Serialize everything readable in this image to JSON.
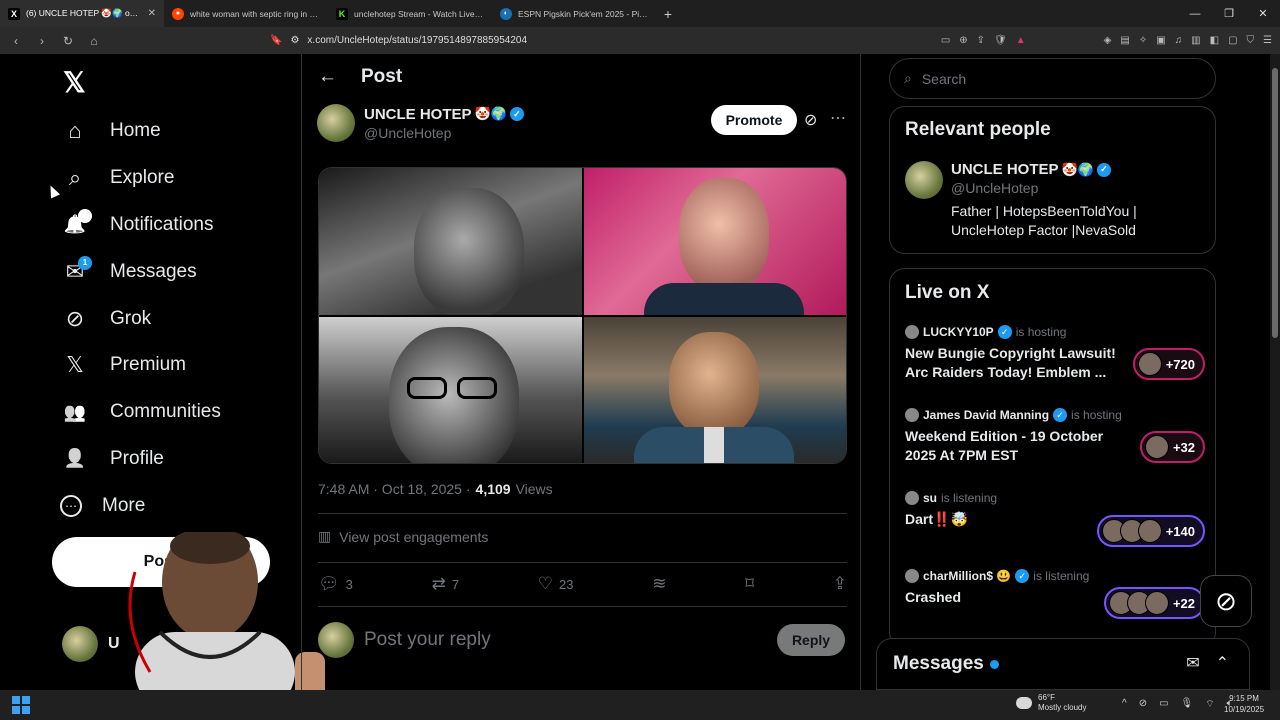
{
  "browser": {
    "tabs": [
      {
        "title": "(6) UNCLE HOTEP 🤡🌍 on X: \"",
        "active": true,
        "icon": "x-favicon"
      },
      {
        "title": "white woman with septic ring in nose",
        "active": false,
        "icon": "reddit-favicon"
      },
      {
        "title": "unclehotep Stream - Watch Live on K",
        "active": false,
        "icon": "kick-favicon"
      },
      {
        "title": "ESPN Pigskin Pick'em 2025 - Picks",
        "active": false,
        "icon": "espn-favicon"
      }
    ],
    "url": "x.com/UncleHotep/status/1979514897885954204"
  },
  "sidebar": {
    "logo": "𝕏",
    "items": [
      {
        "label": "Home",
        "icon": "home-icon",
        "glyph": "⌂"
      },
      {
        "label": "Explore",
        "icon": "search-icon",
        "glyph": "⌕"
      },
      {
        "label": "Notifications",
        "icon": "bell-icon",
        "glyph": "🔔",
        "badge": "5"
      },
      {
        "label": "Messages",
        "icon": "envelope-icon",
        "glyph": "✉",
        "badge": "1"
      },
      {
        "label": "Grok",
        "icon": "grok-icon",
        "glyph": "⊘"
      },
      {
        "label": "Premium",
        "icon": "x-premium-icon",
        "glyph": "𝕏"
      },
      {
        "label": "Communities",
        "icon": "people-icon",
        "glyph": "👥"
      },
      {
        "label": "Profile",
        "icon": "person-icon",
        "glyph": "👤"
      },
      {
        "label": "More",
        "icon": "more-circle-icon",
        "glyph": "⋯"
      }
    ],
    "post_button": "Post",
    "account_initial": "U"
  },
  "main": {
    "header_title": "Post",
    "author": {
      "name": "UNCLE HOTEP",
      "emojis": "🤡🌍",
      "handle": "@UncleHotep"
    },
    "promote_label": "Promote",
    "time": "7:48 AM · Oct 18, 2025 ·",
    "views_count": "4,109",
    "views_label": "Views",
    "engagements_label": "View post engagements",
    "actions": {
      "replies": "3",
      "reposts": "7",
      "likes": "23"
    },
    "reply_placeholder": "Post your reply",
    "reply_button": "Reply"
  },
  "right": {
    "search_placeholder": "Search",
    "relevant_title": "Relevant people",
    "relevant_person": {
      "name": "UNCLE HOTEP",
      "emojis": "🤡🌍",
      "handle": "@UncleHotep",
      "bio": "Father | HotepsBeenToldYou | UncleHotep Factor |NevaSold"
    },
    "live_title": "Live on X",
    "live_items": [
      {
        "host": "LUCKYY10P",
        "verified": true,
        "status": "is hosting",
        "title": "New Bungie Copyright Lawsuit! Arc Raiders Today! Emblem ...",
        "count": "+720",
        "color": "pink"
      },
      {
        "host": "James David Manning",
        "verified": true,
        "status": "is hosting",
        "title": "Weekend Edition - 19 October 2025 At 7PM EST",
        "count": "+32",
        "color": "pink"
      },
      {
        "host": "su",
        "verified": false,
        "status": "is listening",
        "title": "Dart‼️🤯",
        "count": "+140",
        "color": "purple"
      },
      {
        "host": "charMillion$ 😃",
        "verified": true,
        "status": "is listening",
        "title": "Crashed",
        "count": "+22",
        "color": "purple"
      }
    ],
    "messages_title": "Messages"
  },
  "taskbar": {
    "weather_temp": "66°F",
    "weather_desc": "Mostly cloudy",
    "time": "9:15 PM",
    "date": "10/19/2025"
  },
  "colors": {
    "accent": "#1d9bf0",
    "border": "#2f3336",
    "muted": "#71767b",
    "live_pink": "#c01f68",
    "live_purple": "#7856ff"
  }
}
